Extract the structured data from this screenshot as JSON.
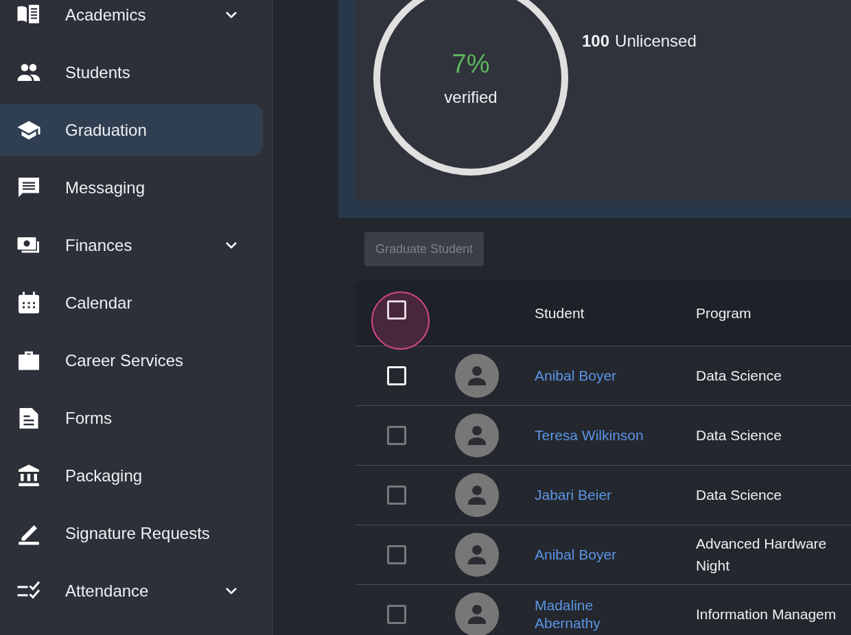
{
  "sidebar": {
    "items": [
      {
        "label": "Academics",
        "selected": false,
        "expandable": true
      },
      {
        "label": "Students",
        "selected": false,
        "expandable": false
      },
      {
        "label": "Graduation",
        "selected": true,
        "expandable": false
      },
      {
        "label": "Messaging",
        "selected": false,
        "expandable": false
      },
      {
        "label": "Finances",
        "selected": false,
        "expandable": true
      },
      {
        "label": "Calendar",
        "selected": false,
        "expandable": false
      },
      {
        "label": "Career Services",
        "selected": false,
        "expandable": false
      },
      {
        "label": "Forms",
        "selected": false,
        "expandable": false
      },
      {
        "label": "Packaging",
        "selected": false,
        "expandable": false
      },
      {
        "label": "Signature Requests",
        "selected": false,
        "expandable": false
      },
      {
        "label": "Attendance",
        "selected": false,
        "expandable": true
      }
    ]
  },
  "summary": {
    "percent": "7%",
    "percent_caption": "verified",
    "stats": [
      {
        "count": "100",
        "label": "Unlicensed"
      }
    ]
  },
  "graduate_button": {
    "label": "Graduate Student",
    "disabled": true
  },
  "table": {
    "select_all": {
      "checked": false,
      "focused": true
    },
    "columns": [
      "Student",
      "Program"
    ],
    "rows": [
      {
        "checked": false,
        "hovered": true,
        "student": "Anibal Boyer",
        "program": [
          "Data Science"
        ]
      },
      {
        "checked": false,
        "hovered": false,
        "student": "Teresa Wilkinson",
        "program": [
          "Data Science"
        ]
      },
      {
        "checked": false,
        "hovered": false,
        "student": "Jabari Beier",
        "program": [
          "Data Science"
        ]
      },
      {
        "checked": false,
        "hovered": false,
        "student": "Anibal Boyer",
        "program": [
          "Advanced Hardware",
          "Night"
        ]
      },
      {
        "checked": false,
        "hovered": false,
        "student": "Madaline Abernathy",
        "program": [
          "Information Managem"
        ]
      }
    ]
  }
}
